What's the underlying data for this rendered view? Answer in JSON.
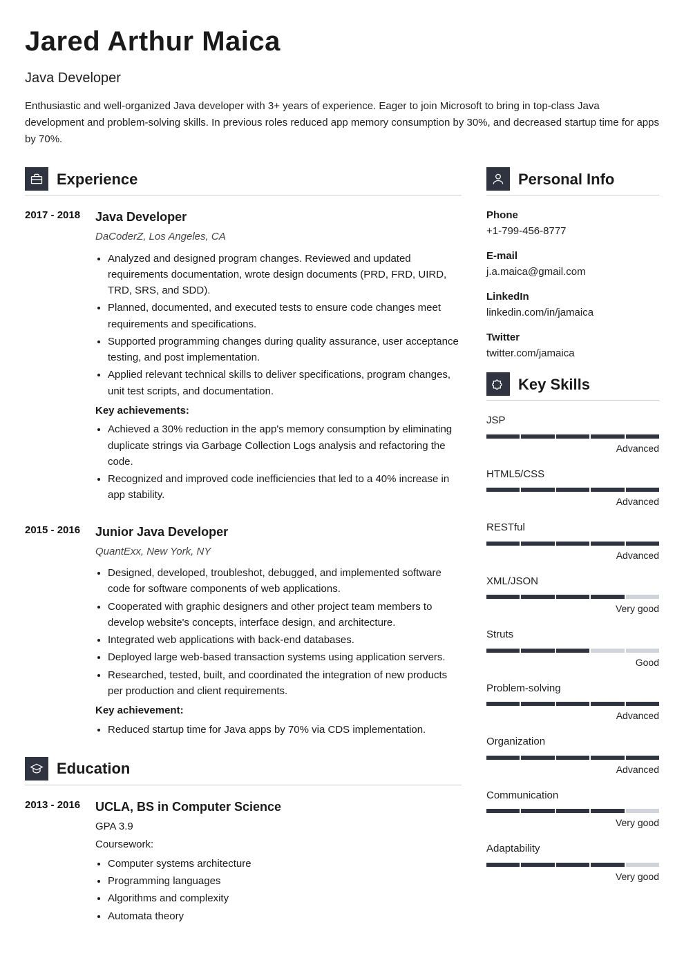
{
  "header": {
    "name": "Jared Arthur Maica",
    "role": "Java Developer",
    "summary": "Enthusiastic and well-organized Java developer with 3+ years of experience. Eager to join Microsoft to bring in top-class Java development and problem-solving skills. In previous roles reduced app memory consumption by 30%, and decreased startup time for apps by 70%."
  },
  "sections": {
    "experience": "Experience",
    "education": "Education",
    "personal": "Personal Info",
    "skills": "Key Skills"
  },
  "experience": [
    {
      "dates": "2017 - 2018",
      "title": "Java Developer",
      "sub": "DaCoderZ, Los Angeles, CA",
      "bullets": [
        "Analyzed and designed program changes. Reviewed and updated requirements documentation, wrote design documents (PRD, FRD, UIRD, TRD, SRS, and SDD).",
        "Planned, documented, and executed tests to ensure code changes meet requirements and specifications.",
        "Supported programming changes during quality assurance, user acceptance testing, and post implementation.",
        "Applied relevant technical skills to deliver specifications, program changes, unit test scripts, and documentation."
      ],
      "ach_label": "Key achievements:",
      "achievements": [
        "Achieved a 30% reduction in the app's memory consumption by eliminating duplicate strings via Garbage Collection Logs analysis and refactoring the code.",
        "Recognized and improved code inefficiencies that led to a 40% increase in app stability."
      ]
    },
    {
      "dates": "2015 - 2016",
      "title": "Junior Java Developer",
      "sub": "QuantExx, New York, NY",
      "bullets": [
        "Designed, developed, troubleshot, debugged, and implemented software code for software components of web applications.",
        "Cooperated with graphic designers and other project team members to develop website's concepts, interface design, and architecture.",
        "Integrated web applications with back-end databases.",
        "Deployed large web-based transaction systems using application servers.",
        "Researched, tested, built, and coordinated the integration of new products per production and client requirements."
      ],
      "ach_label": "Key achievement:",
      "achievements": [
        "Reduced startup time for Java apps by 70% via CDS implementation."
      ]
    }
  ],
  "education": [
    {
      "dates": "2013 - 2016",
      "title": "UCLA, BS in Computer Science",
      "gpa": "GPA 3.9",
      "coursework_label": "Coursework:",
      "courses": [
        "Computer systems architecture",
        "Programming languages",
        "Algorithms and complexity",
        "Automata theory"
      ]
    }
  ],
  "personal": [
    {
      "label": "Phone",
      "value": "+1-799-456-8777"
    },
    {
      "label": "E-mail",
      "value": "j.a.maica@gmail.com"
    },
    {
      "label": "LinkedIn",
      "value": "linkedin.com/in/jamaica"
    },
    {
      "label": "Twitter",
      "value": "twitter.com/jamaica"
    }
  ],
  "skills": [
    {
      "name": "JSP",
      "level": "Advanced",
      "score": 5
    },
    {
      "name": "HTML5/CSS",
      "level": "Advanced",
      "score": 5
    },
    {
      "name": "RESTful",
      "level": "Advanced",
      "score": 5
    },
    {
      "name": "XML/JSON",
      "level": "Very good",
      "score": 4
    },
    {
      "name": "Struts",
      "level": "Good",
      "score": 3
    },
    {
      "name": "Problem-solving",
      "level": "Advanced",
      "score": 5
    },
    {
      "name": "Organization",
      "level": "Advanced",
      "score": 5
    },
    {
      "name": "Communication",
      "level": "Very good",
      "score": 4
    },
    {
      "name": "Adaptability",
      "level": "Very good",
      "score": 4
    }
  ]
}
